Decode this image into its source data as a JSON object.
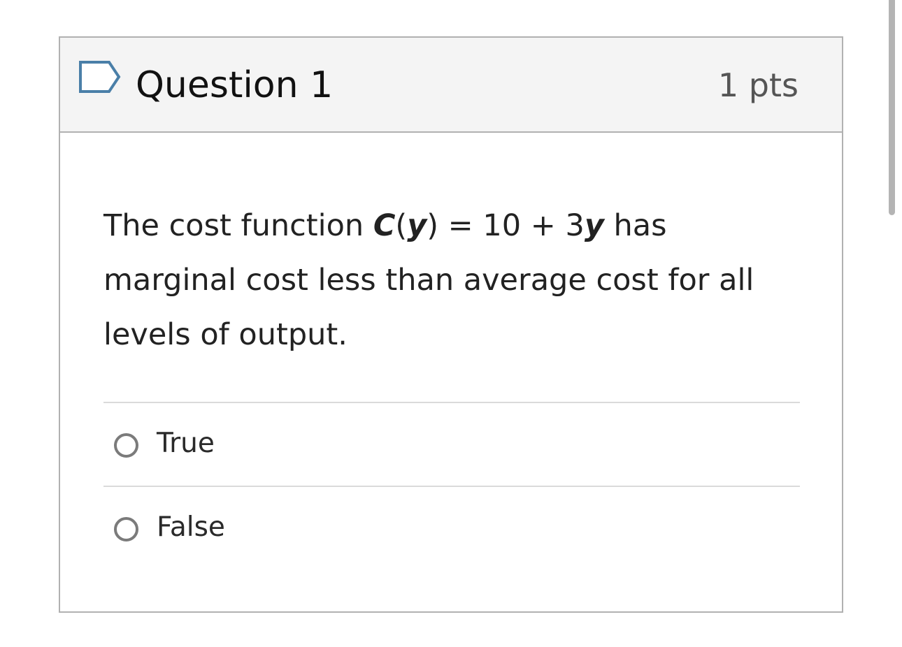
{
  "question": {
    "title": "Question 1",
    "points": "1 pts",
    "flag_icon": "flag-icon",
    "text": {
      "part1": "The cost function ",
      "func_name": "C",
      "paren_open": "(",
      "func_var": "y",
      "paren_close": ")",
      "part2": " = 10 + 3",
      "var": "y",
      "part3": " has marginal cost less than average cost for all levels of output."
    },
    "answers": [
      {
        "label": "True",
        "selected": false
      },
      {
        "label": "False",
        "selected": false
      }
    ]
  },
  "colors": {
    "header_bg": "#f4f4f4",
    "border": "#b1b1b1",
    "flag_stroke": "#4a7fa8",
    "radio_border": "#7b7b7b"
  }
}
